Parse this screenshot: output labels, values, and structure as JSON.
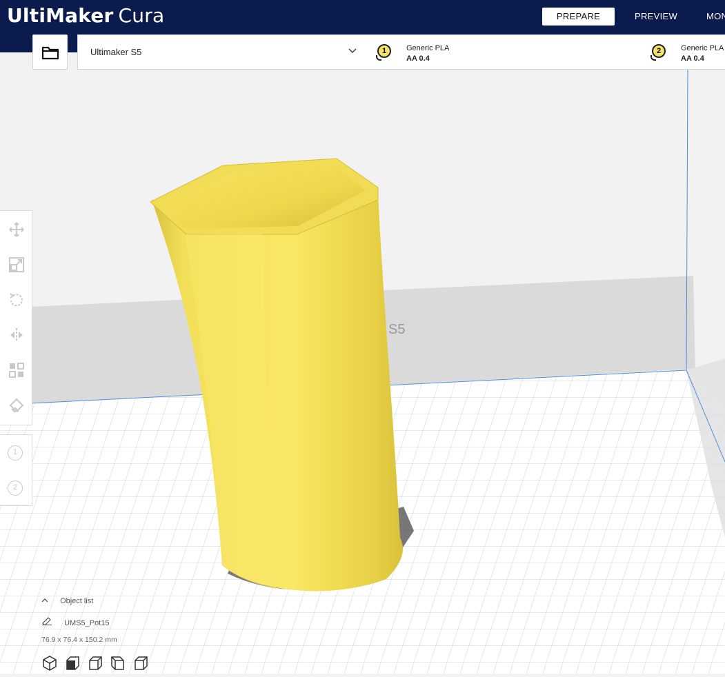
{
  "app": {
    "logo_bold": "UltiMaker",
    "logo_light": "Cura"
  },
  "nav": {
    "prepare": "PREPARE",
    "preview": "PREVIEW",
    "monitor": "MONITOR"
  },
  "machine": {
    "selected": "Ultimaker S5"
  },
  "extruders": [
    {
      "number": "1",
      "material": "Generic PLA",
      "core": "AA 0.4"
    },
    {
      "number": "2",
      "material": "Generic PLA",
      "core": "AA 0.4"
    }
  ],
  "buildplate": {
    "back_label": "S5"
  },
  "object_list": {
    "toggle_label": "Object list",
    "object_name": "UMS5_Pot15",
    "dimensions": "76.9 x 76.4 x 150.2 mm"
  },
  "colors": {
    "header": "#0c1b4d",
    "model_yellow": "#f6e15a",
    "grid_line": "#c9d0da",
    "buildvolume_edge": "#4a8de0"
  },
  "icons": {
    "tools": [
      "move-icon",
      "scale-icon",
      "rotate-icon",
      "mirror-icon",
      "per-model-settings-icon",
      "support-blocker-icon"
    ],
    "views": [
      "3d-view-icon",
      "front-view-icon",
      "top-view-icon",
      "left-view-icon",
      "right-view-icon"
    ]
  }
}
